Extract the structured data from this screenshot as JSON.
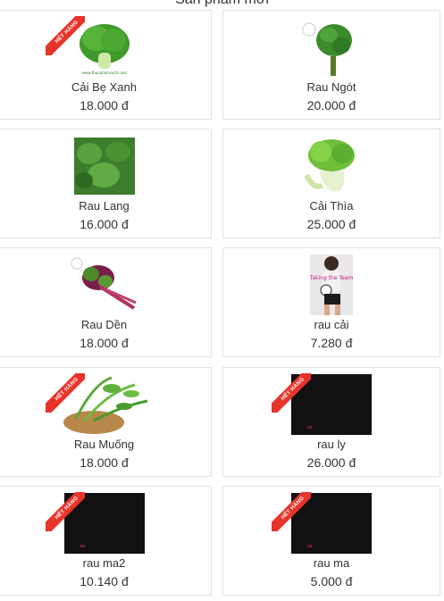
{
  "section": {
    "title": "Sản phẩm mới"
  },
  "badge": {
    "out_of_stock": "HẾT HÀNG"
  },
  "products": [
    {
      "name": "Cải Bẹ Xanh",
      "price": "18.000 đ",
      "out_of_stock": true,
      "image": "bok-choy-greens"
    },
    {
      "name": "Rau Ngót",
      "price": "20.000 đ",
      "out_of_stock": false,
      "image": "katuk-leaves"
    },
    {
      "name": "Rau Lang",
      "price": "16.000 đ",
      "out_of_stock": false,
      "image": "sweet-potato-leaves"
    },
    {
      "name": "Cải Thìa",
      "price": "25.000 đ",
      "out_of_stock": false,
      "image": "bok-choy"
    },
    {
      "name": "Rau Dền",
      "price": "18.000 đ",
      "out_of_stock": false,
      "image": "amaranth"
    },
    {
      "name": "rau cải",
      "price": "7.280 đ",
      "out_of_stock": false,
      "image": "photo-poster"
    },
    {
      "name": "Rau Muống",
      "price": "18.000 đ",
      "out_of_stock": true,
      "image": "water-spinach"
    },
    {
      "name": "rau ly",
      "price": "26.000 đ",
      "out_of_stock": true,
      "image": "black-placeholder"
    },
    {
      "name": "rau ma2",
      "price": "10.140 đ",
      "out_of_stock": true,
      "image": "black-placeholder"
    },
    {
      "name": "rau ma",
      "price": "5.000 đ",
      "out_of_stock": true,
      "image": "black-placeholder"
    }
  ],
  "colors": {
    "badge": "#e8342a",
    "border": "#e2e2e2",
    "text": "#333333"
  }
}
